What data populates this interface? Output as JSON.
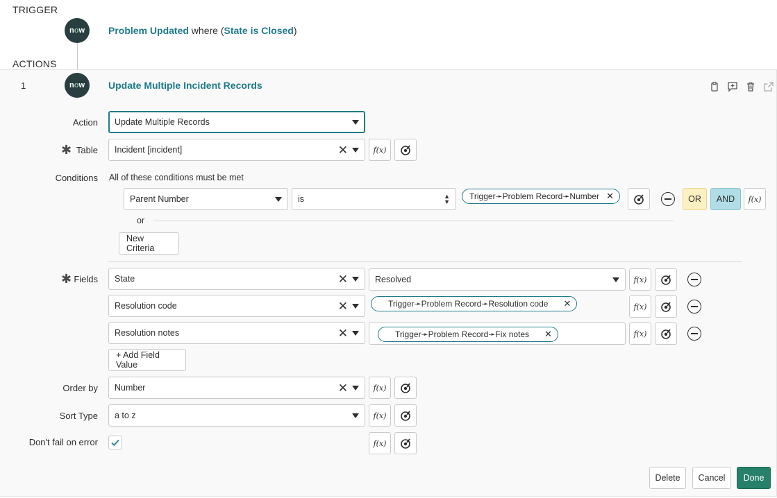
{
  "trigger": {
    "section_label": "TRIGGER",
    "logo_text_pre": "n",
    "logo_text_o": "o",
    "logo_text_post": "w",
    "link": "Problem Updated",
    "where_text": "where (",
    "condition_link": "State is Closed",
    "close_paren": ")"
  },
  "actions": {
    "section_label": "ACTIONS",
    "number": "1",
    "title": "Update Multiple Incident Records"
  },
  "form": {
    "action_label": "Action",
    "action_value": "Update Multiple Records",
    "table_label": "Table",
    "table_value": "Incident [incident]",
    "conditions_label": "Conditions",
    "conditions_hint": "All of these conditions must be met",
    "condition_field": "Parent Number",
    "condition_operator": "is",
    "condition_pill": "Trigger➛Problem Record➛Number",
    "or_button": "OR",
    "and_button": "AND",
    "or_separator": "or",
    "new_criteria": "New Criteria",
    "fields_label": "Fields",
    "fields": [
      {
        "name": "State",
        "value": "Resolved"
      },
      {
        "name": "Resolution code",
        "value": "Trigger➛Problem Record➛Resolution code"
      },
      {
        "name": "Resolution notes",
        "value": "Trigger➛Problem Record➛Fix notes"
      }
    ],
    "add_field_value": "+ Add Field Value",
    "order_by_label": "Order by",
    "order_by_value": "Number",
    "sort_type_label": "Sort Type",
    "sort_type_value": "a to z",
    "dont_fail_label": "Don't fail on error",
    "fx_label": "f(x)"
  },
  "footer": {
    "delete": "Delete",
    "cancel": "Cancel",
    "done": "Done"
  },
  "colors": {
    "accent": "#1f7a8c",
    "primary_button": "#278069",
    "or_bg": "#fdf1c3",
    "and_bg": "#b0dde6",
    "logo_bg": "#293e40"
  }
}
